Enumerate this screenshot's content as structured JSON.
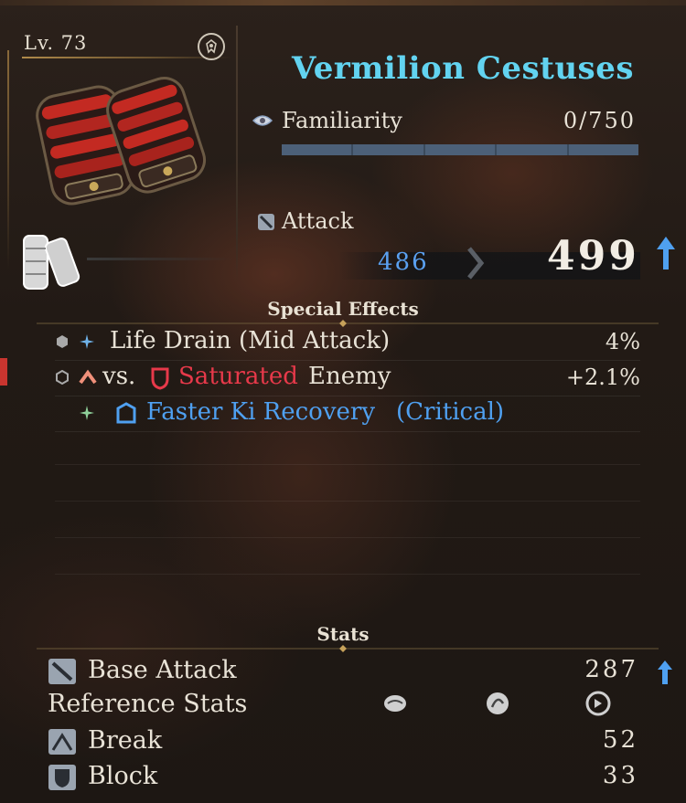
{
  "item": {
    "level": "Lv. 73",
    "name": "Vermilion Cestuses",
    "familiarity": {
      "label": "Familiarity",
      "value": "0/750",
      "progress": 0.0
    },
    "attack": {
      "label": "Attack",
      "current": "486",
      "new": "499"
    }
  },
  "special_effects": {
    "title": "Special Effects",
    "effects": [
      {
        "text": "Life Drain (Mid Attack)",
        "value": "4%"
      },
      {
        "prefix": "vs.",
        "keyword": "Saturated",
        "suffix": "Enemy",
        "value": "+2.1%"
      },
      {
        "text": "Faster Ki Recovery",
        "qualifier": "(Critical)",
        "value": ""
      }
    ]
  },
  "stats": {
    "title": "Stats",
    "base_attack": {
      "label": "Base Attack",
      "value": "287"
    },
    "reference_label": "Reference Stats",
    "reference_icons": [
      "strength-stat-icon",
      "skill-stat-icon",
      "dexterity-stat-icon"
    ],
    "break": {
      "label": "Break",
      "value": "52"
    },
    "block": {
      "label": "Block",
      "value": "33"
    }
  },
  "colors": {
    "title": "#62d3f0",
    "attack_old": "#5aa0f0",
    "saturated": "#e7394a",
    "faster_ki": "#4fa0f0",
    "upgrade_arrow": "#4fa0f0"
  }
}
